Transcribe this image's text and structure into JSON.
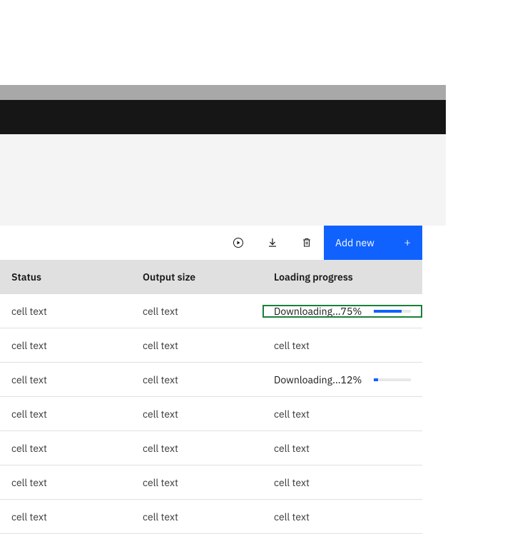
{
  "toolbar": {
    "add_label": "Add new"
  },
  "table": {
    "headers": {
      "status": "Status",
      "output_size": "Output size",
      "loading_progress": "Loading progress"
    },
    "rows": [
      {
        "status": "cell text",
        "size": "cell text",
        "progress_label": "Downloading...75%",
        "progress_pct": 75,
        "highlight": true
      },
      {
        "status": "cell text",
        "size": "cell text",
        "progress_text": "cell text"
      },
      {
        "status": "cell text",
        "size": "cell text",
        "progress_label": "Downloading...12%",
        "progress_pct": 12
      },
      {
        "status": "cell text",
        "size": "cell text",
        "progress_text": "cell text"
      },
      {
        "status": "cell text",
        "size": "cell text",
        "progress_text": "cell text"
      },
      {
        "status": "cell text",
        "size": "cell text",
        "progress_text": "cell text"
      },
      {
        "status": "cell text",
        "size": "cell text",
        "progress_text": "cell text"
      }
    ]
  },
  "colors": {
    "primary": "#0f62fe",
    "highlight": "#198038"
  }
}
